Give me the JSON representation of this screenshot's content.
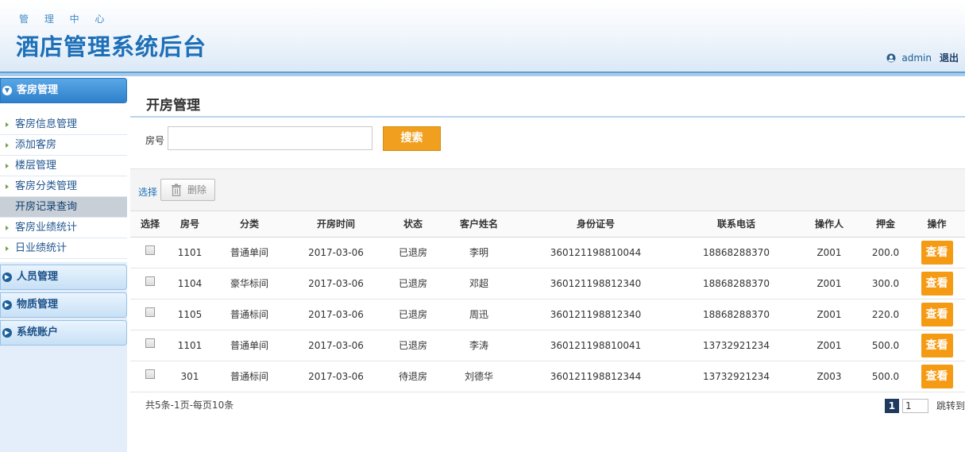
{
  "header": {
    "subtitle": "管 理 中 心",
    "title": "酒店管理系统后台",
    "user": "admin",
    "logout": "退出"
  },
  "sidebar": {
    "panels": [
      {
        "label": "客房管理",
        "items": [
          "客房信息管理",
          "添加客房",
          "楼层管理",
          "客房分类管理",
          "开房记录查询",
          "客房业绩统计",
          "日业绩统计"
        ]
      },
      {
        "label": "人员管理"
      },
      {
        "label": "物质管理"
      },
      {
        "label": "系统账户"
      }
    ]
  },
  "main": {
    "title": "开房管理",
    "search": {
      "label": "房号",
      "value": "",
      "button": "搜索"
    },
    "toolbar": {
      "select": "选择",
      "delete": "删除"
    },
    "table": {
      "columns": [
        "选择",
        "房号",
        "分类",
        "开房时间",
        "状态",
        "客户姓名",
        "身份证号",
        "联系电话",
        "操作人",
        "押金",
        "操作"
      ],
      "rows": [
        [
          "1101",
          "普通单间",
          "2017-03-06",
          "已退房",
          "李明",
          "360121198810044",
          "18868288370",
          "Z001",
          "200.0",
          "查看"
        ],
        [
          "1104",
          "豪华标间",
          "2017-03-06",
          "已退房",
          "邓超",
          "360121198812340",
          "18868288370",
          "Z001",
          "300.0",
          "查看"
        ],
        [
          "1105",
          "普通标间",
          "2017-03-06",
          "已退房",
          "周迅",
          "360121198812340",
          "18868288370",
          "Z001",
          "220.0",
          "查看"
        ],
        [
          "1101",
          "普通单间",
          "2017-03-06",
          "已退房",
          "李涛",
          "360121198810041",
          "13732921234",
          "Z001",
          "500.0",
          "查看"
        ],
        [
          "301",
          "普通标间",
          "2017-03-06",
          "待退房",
          "刘德华",
          "360121198812344",
          "13732921234",
          "Z003",
          "500.0",
          "查看"
        ]
      ]
    },
    "pager": {
      "summary": "共5条-1页-每页10条",
      "current": "1",
      "input": "1",
      "jump": "跳转到"
    }
  }
}
